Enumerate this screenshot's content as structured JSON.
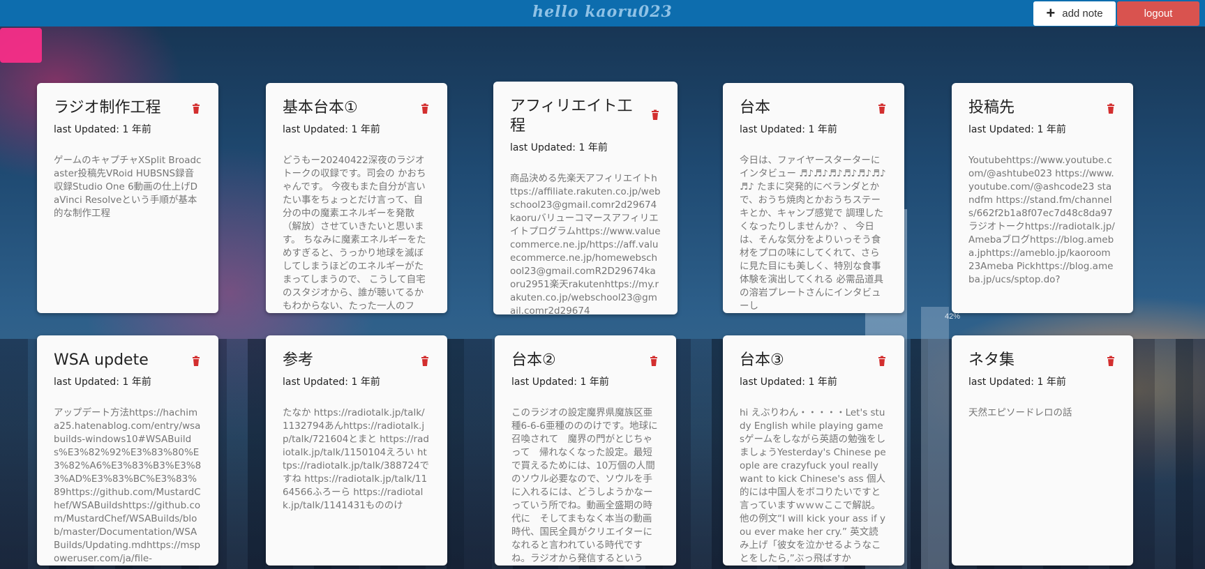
{
  "header": {
    "brand": "hello kaoru023",
    "add_label": "add note",
    "logout_label": "logout"
  },
  "background": {
    "badge": "42%"
  },
  "cards": [
    {
      "title": "ラジオ制作工程",
      "updated": "last Updated: 1 年前",
      "body": "ゲームのキャプチャXSplit Broadcaster投稿先VRoid HUBSNS録音収録Studio One 6動画の仕上げDaVinci Resolveという手順が基本的な制作工程"
    },
    {
      "title": "基本台本①",
      "updated": "last Updated: 1 年前",
      "body": "どうもー20240422深夜のラジオトークの収録です。司会の かおちゃんです。 今夜もまた自分が言いたい事をちょっとだけ言って、自分の中の魔素エネルギーを発散（解放）させていきたいと思います。 ちなみに魔素エネルギーをためすぎると、うっかり地球を滅ぼしてしまうほどのエネルギーがたまってしまうので、 こうして自宅のスタジオから、誰が聴いてるかもわからない、たった一人のフ"
    },
    {
      "title": "アフィリエイト工程",
      "updated": "last Updated: 1 年前",
      "body": "商品決める先楽天アフィリエイトhttps://affiliate.rakuten.co.jp/webschool23@gmail.comr2d29674kaoruバリューコマースアフィリエイトプログラムhttps://www.valuecommerce.ne.jp/https://aff.valuecommerce.ne.jp/homewebschool23@gmail.comR2D29674kaoru2951楽天rakutenhttps://my.rakuten.co.jp/webschool23@gmail.comr2d29674"
    },
    {
      "title": "台本",
      "updated": "last Updated: 1 年前",
      "body": "今日は、ファイヤースターターにインタビュー ♬♪♬♪♬♪♬♪♬♪♬♪♬♪ たまに突発的にベランダとかで、おうち焼肉とかおうちステーキとか、キャンプ感覚で 調理したくなったりしませんか？、 今日は、そんな気分をよりいっそう食材をプロの味にしてくれて、さらに見た目にも美しく、特別な食事体験を演出してくれる 必需品道具の溶岩プレートさんにインタビューし"
    },
    {
      "title": "投稿先",
      "updated": "last Updated: 1 年前",
      "body": "Youtubehttps://www.youtube.com/@ashtube023 https://www.youtube.com/@ashcode23 standfm https://stand.fm/channels/662f2b1a8f07ec7d48c8da97 ラジオトークhttps://radiotalk.jp/Amebaブログhttps://blog.ameba.jphttps://ameblo.jp/kaoroom23Ameba Pickhttps://blog.ameba.jp/ucs/sptop.do?"
    },
    {
      "title": "WSA updete",
      "updated": "last Updated: 1 年前",
      "body": "アップデート方法https://hachima25.hatenablog.com/entry/wsabuilds-windows10#WSABuilds%E3%82%92%E3%83%80%E3%82%A6%E3%83%B3%E3%83%AD%E3%83%BC%E3%83%89https://github.com/MustardChef/WSABuildshttps://github.com/MustardChef/WSABuilds/blob/master/Documentation/WSABuilds/Updating.mdhttps://mspoweruser.com/ja/file-"
    },
    {
      "title": "参考",
      "updated": "last Updated: 1 年前",
      "body": "たなか https://radiotalk.jp/talk/1132794あんhttps://radiotalk.jp/talk/721604とまと https://radiotalk.jp/talk/1150104えろい https://radiotalk.jp/talk/388724ですね https://radiotalk.jp/talk/1164566ふろーら https://radiotalk.jp/talk/1141431もののけ"
    },
    {
      "title": "台本②",
      "updated": "last Updated: 1 年前",
      "body": "このラジオの設定魔界県魔族区亜種6-6-6亜種のののけです。地球に召喚されて　魔界の門がとじちゃって　帰れなくなった設定。最短で買えるためには、10万個の人間のソウル必要なので、ソウルを手に入れるには、どうしようかなーっていう所でね。動画全盛期の時代に　そしてまもなく本当の動画時代、国民全員がクリエイターになれると言われている時代ですね。ラジオから発信するという"
    },
    {
      "title": "台本③",
      "updated": "last Updated: 1 年前",
      "body": "hi えぶりわん・・・・・Let's study English while playing gamesゲームをしながら英語の勉強をしましょうYesterday's Chinese people are crazyfuck youI really want to kick Chinese's ass 個人的には中国人をボコりたいですと言っていますｗｗｗここで解説。他の例文“I will kick your ass if you ever make her cry.” 英文読み上げ「彼女を泣かせるようなことをしたら,”ぶっ飛ばすか"
    },
    {
      "title": "ネタ集",
      "updated": "last Updated: 1 年前",
      "body": "天然エピソードレロの話"
    }
  ]
}
